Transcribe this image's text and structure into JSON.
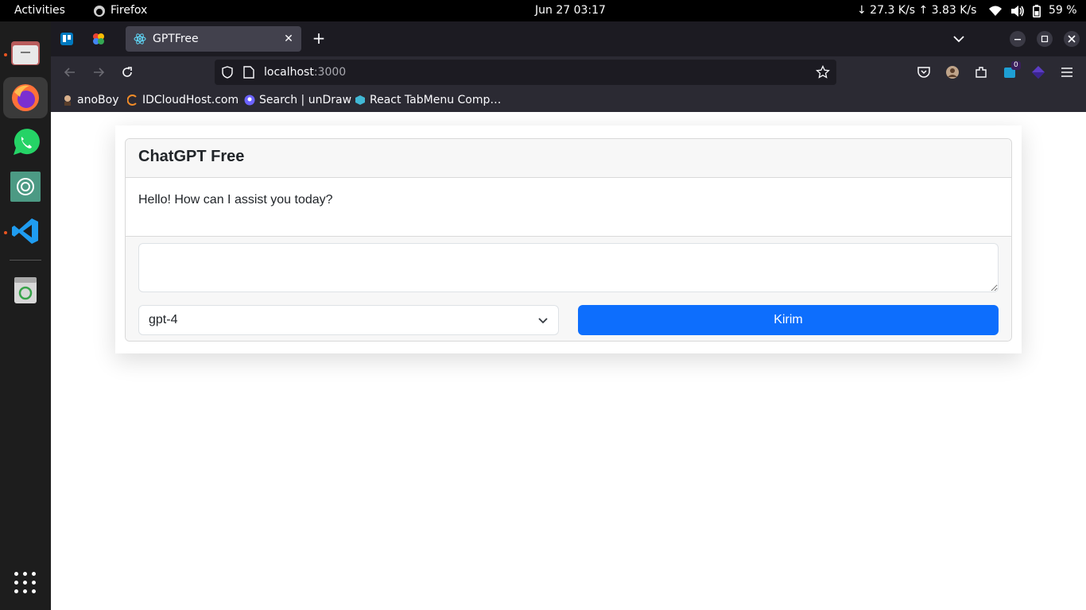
{
  "topbar": {
    "activities": "Activities",
    "app_name": "Firefox",
    "clock": "Jun 27  03:17",
    "netspeed": "↓ 27.3 K/s ↑ 3.83 K/s",
    "battery": "59 %"
  },
  "dock": {
    "apps": [
      "files-icon",
      "firefox-icon",
      "whatsapp-icon",
      "chatgpt-icon",
      "vscode-icon",
      "trash-icon"
    ]
  },
  "browser": {
    "tab_title": "GPTFree",
    "tab_close": "✕",
    "new_tab": "+",
    "url_host": "localhost",
    "url_port": ":3000",
    "extension_badge": "0",
    "bookmarks": [
      {
        "label": "anoBoy"
      },
      {
        "label": "IDCloudHost.com"
      },
      {
        "label": "Search | unDraw"
      },
      {
        "label": "React TabMenu Comp…"
      }
    ]
  },
  "page": {
    "title": "ChatGPT Free",
    "message": "Hello! How can I assist you today?",
    "prompt_value": "",
    "model_selected": "gpt-4",
    "send_label": "Kirim"
  },
  "colors": {
    "accent": "#0d6efd",
    "dock_indicator": "#e95420"
  }
}
